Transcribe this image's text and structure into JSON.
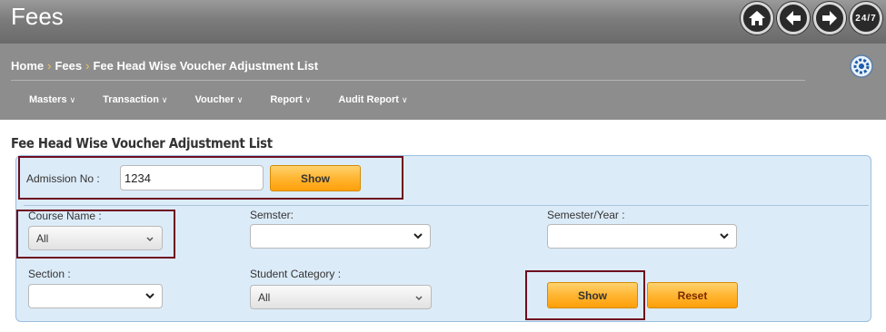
{
  "app": {
    "title": "Fees"
  },
  "header_icons": [
    {
      "name": "home-icon"
    },
    {
      "name": "back-arrow-icon"
    },
    {
      "name": "forward-arrow-icon"
    },
    {
      "name": "support-247-icon",
      "label": "24/7"
    }
  ],
  "breadcrumb": {
    "items": [
      "Home",
      "Fees",
      "Fee Head Wise Voucher Adjustment List"
    ],
    "separator": "›"
  },
  "menu": {
    "items": [
      {
        "label": "Masters"
      },
      {
        "label": "Transaction"
      },
      {
        "label": "Voucher"
      },
      {
        "label": "Report"
      },
      {
        "label": "Audit Report"
      }
    ]
  },
  "page": {
    "title": "Fee Head Wise Voucher Adjustment List"
  },
  "form": {
    "admission_no": {
      "label": "Admission No :",
      "value": "1234"
    },
    "show_top": "Show",
    "course_name": {
      "label": "Course Name :",
      "value": "All"
    },
    "semester": {
      "label": "Semster:",
      "value": ""
    },
    "semester_year": {
      "label": "Semester/Year :",
      "value": ""
    },
    "section": {
      "label": "Section :",
      "value": ""
    },
    "student_category": {
      "label": "Student Category :",
      "value": "All"
    },
    "show_bottom": "Show",
    "reset": "Reset"
  },
  "colors": {
    "header_bg": "#7c7c7c",
    "panel_bg": "#dcebf8",
    "button_orange": "#ffb632",
    "highlight_border": "#6e0d20"
  }
}
